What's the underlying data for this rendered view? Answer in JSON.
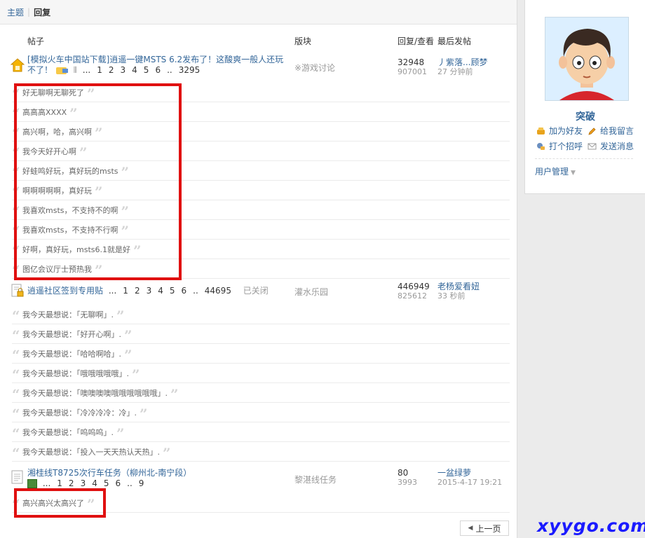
{
  "tabs": [
    "主题",
    "回复"
  ],
  "table_header": {
    "post": "帖子",
    "forum": "版块",
    "counts": "回复/查看",
    "last": "最后发帖"
  },
  "threads": [
    {
      "title": "[模拟火车中国站下载]逍遥一键MSTS 6.2发布了！这酸爽一般人还玩不了！",
      "pages": [
        "...",
        "1",
        "2",
        "3",
        "4",
        "5",
        "6",
        "..",
        "3295"
      ],
      "forum": "※游戏讨论",
      "replies": "32948",
      "views": "907001",
      "last_user": "丿紫落...顾梦",
      "last_time": "27 分钟前",
      "reply_lines": [
        "好无聊啊无聊死了",
        "高高高XXXX",
        "高兴啊，哈，高兴啊",
        "我今天好开心啊",
        "好蛙鸣好玩，真好玩的msts",
        "啊啊啊啊啊，真好玩",
        "我喜欢msts，不支持不的啊",
        "我喜欢msts，不支持不行啊",
        "好啊，真好玩，msts6.1就是好",
        "图亿会议厅士预热我"
      ]
    },
    {
      "title": "逍遥社区签到专用贴",
      "pages": [
        "...",
        "1",
        "2",
        "3",
        "4",
        "5",
        "6",
        "..",
        "44695"
      ],
      "closed": "已关闭",
      "forum": "灌水乐园",
      "replies": "446949",
      "views": "825612",
      "last_user": "老杨爱看妞",
      "last_time": "33 秒前",
      "reply_lines": [
        "我今天最想说：「无聊啊」.",
        "我今天最想说：「好开心啊」.",
        "我今天最想说：「哈哈啊哈」.",
        "我今天最想说：「哦哦哦哦哦」.",
        "我今天最想说：「噢噢噢噢哦哦哦哦哦哦」.",
        "我今天最想说：「冷冷冷冷：冷」.",
        "我今天最想说：「呜呜呜」.",
        "我今天最想说：「投入一天天热认天热」."
      ]
    },
    {
      "title": "湘桂线T8725次行车任务（柳州北-南宁段）",
      "pages": [
        "...",
        "1",
        "2",
        "3",
        "4",
        "5",
        "6",
        "..",
        "9"
      ],
      "forum": "黎湛线任务",
      "replies": "80",
      "views": "3993",
      "last_user": "一盆绿萝",
      "last_time": "2015-4-17 19:21",
      "reply_lines": [
        "高兴高兴太高兴了"
      ]
    }
  ],
  "pagination": {
    "prev": "上一页"
  },
  "profile": {
    "name": "突破",
    "add_friend": "加为好友",
    "leave_message": "给我留言",
    "greet": "打个招呼",
    "send_message": "发送消息",
    "user_manage": "用户管理"
  },
  "watermark": "xyygo.com",
  "colors": {
    "link": "#336699",
    "highlight": "#e01010",
    "watermark": "#1a1aff"
  }
}
